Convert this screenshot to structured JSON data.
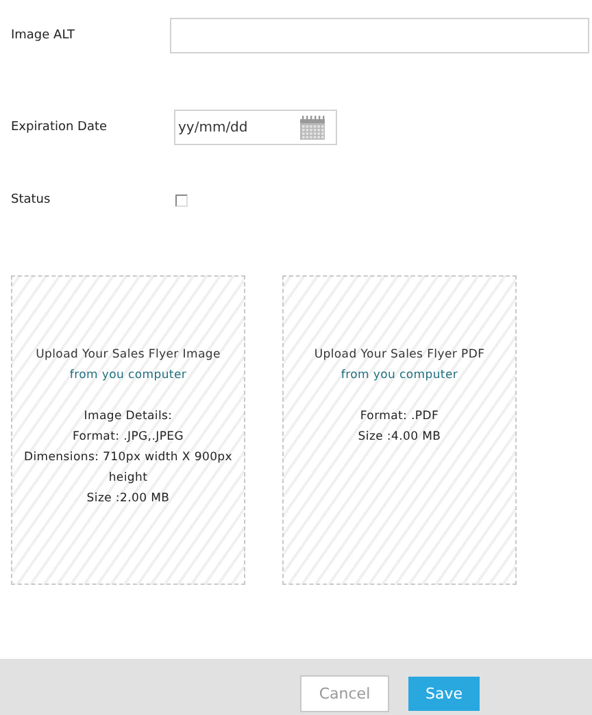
{
  "fields": [
    {
      "kind": "text",
      "label": "Image ALT"
    },
    {
      "kind": "date",
      "label": "Expiration Date",
      "placeholder": "yy/mm/dd"
    },
    {
      "kind": "checkbox",
      "label": "Status",
      "checked": false
    }
  ],
  "uploads": [
    {
      "title": "Upload Your Sales Flyer Image",
      "link": "from you computer",
      "details": [
        "Image Details:",
        "Format: .JPG,.JPEG",
        "Dimensions: 710px width X 900px height",
        "Size :2.00 MB"
      ]
    },
    {
      "title": "Upload Your Sales Flyer PDF",
      "link": "from you computer",
      "details": [
        "Format: .PDF",
        "Size :4.00 MB"
      ]
    }
  ],
  "buttons": [
    {
      "kind": "cancel",
      "label": "Cancel"
    },
    {
      "kind": "save",
      "label": "Save"
    }
  ]
}
